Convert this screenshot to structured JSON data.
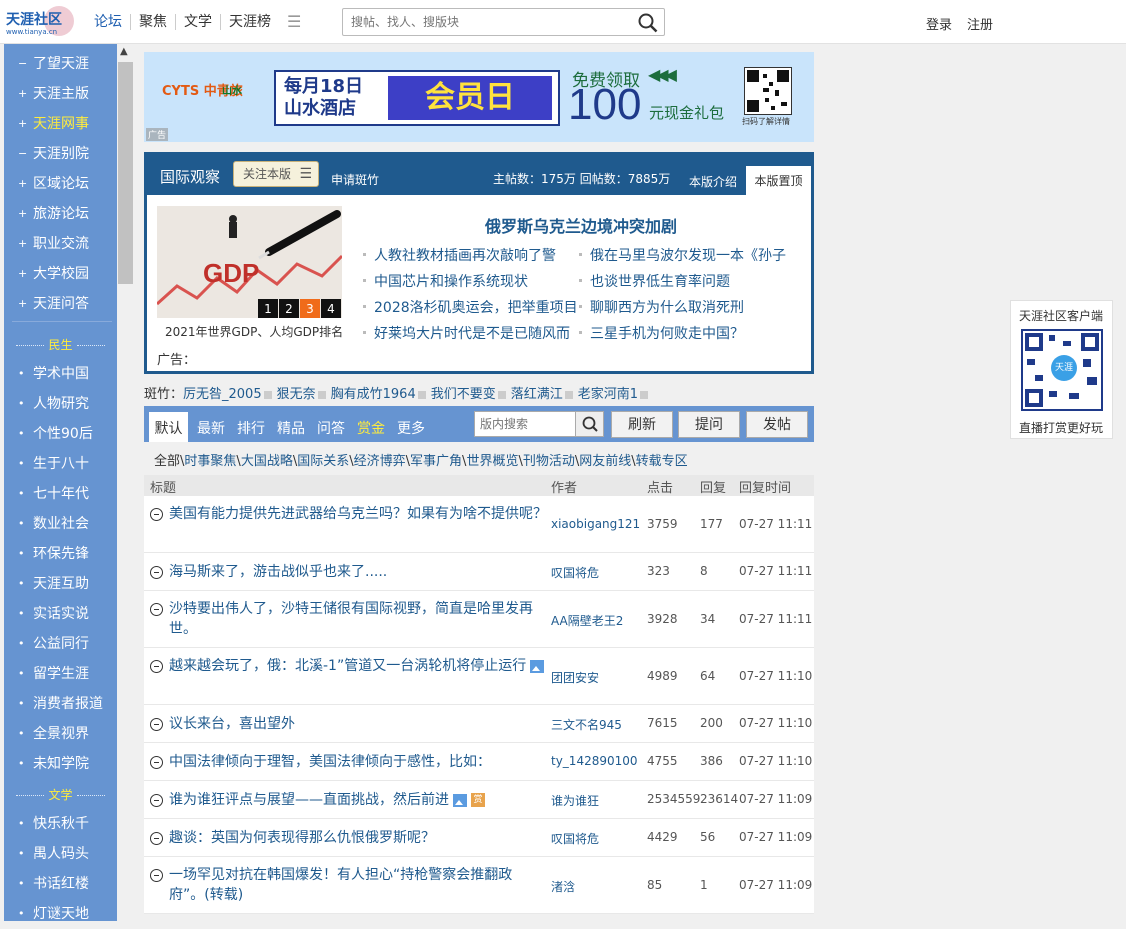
{
  "logo": {
    "text": "天涯社区",
    "url_text": "www.tianya.cn"
  },
  "topnav": {
    "items": [
      "论坛",
      "聚焦",
      "文学",
      "天涯榜"
    ],
    "menu_icon": "menu-icon"
  },
  "search": {
    "placeholder": "搜帖、找人、搜版块",
    "icon": "search-icon"
  },
  "account": {
    "login": "登录",
    "register": "注册"
  },
  "sidebar": {
    "items1": [
      "了望天涯",
      "天涯主版",
      "天涯网事",
      "天涯别院",
      "区域论坛",
      "旅游论坛",
      "职业交流",
      "大学校园",
      "天涯问答"
    ],
    "marks1": [
      "−",
      "+",
      "+",
      "−",
      "+",
      "+",
      "+",
      "+",
      "+"
    ],
    "highlight_index": 2,
    "section2": "民生",
    "items2": [
      "学术中国",
      "人物研究",
      "个性90后",
      "生于八十",
      "七十年代",
      "数业社会",
      "环保先锋",
      "天涯互助",
      "实话实说",
      "公益同行",
      "留学生涯",
      "消费者报道",
      "全景视界",
      "未知学院"
    ],
    "section3": "文学",
    "items3": [
      "快乐秋千",
      "禺人码头",
      "书话红楼",
      "灯谜天地"
    ]
  },
  "banner": {
    "logo_cits": "CYTS 中青旅",
    "logo_hotel": "山水",
    "monthly": "每月18日",
    "hotel": "山水酒店",
    "member_day": "会员日",
    "free": "免费领取",
    "amount": "100",
    "cash": "元现金礼包",
    "qr_caption": "扫码了解详情",
    "ad_label": "广告"
  },
  "board": {
    "title": "国际观察",
    "follow": "关注本版",
    "apply": "申请斑竹",
    "stats": "主帖数：175万 回帖数：7885万",
    "intro": "本版介绍",
    "top": "本版置顶",
    "pic_caption": "2021年世界GDP、人均GDP排名",
    "pic_text": "GDP",
    "pages": [
      "1",
      "2",
      "3",
      "4"
    ],
    "active_page": 2,
    "headline": "俄罗斯乌克兰边境冲突加剧",
    "news_left": [
      "人教社教材插画再次敲响了警",
      "中国芯片和操作系统现状",
      "2028洛杉矶奥运会，把举重项目",
      "好莱坞大片时代是不是已随风而"
    ],
    "news_right": [
      "俄在马里乌波尔发现一本《孙子",
      "也谈世界低生育率问题",
      "聊聊西方为什么取消死刑",
      "三星手机为何败走中国？"
    ],
    "ad": "广告："
  },
  "moderators": {
    "label": "斑竹：",
    "names": [
      "厉无咎_2005",
      "狠无奈",
      "胸有成竹1964",
      "我们不要变",
      "落红满江",
      "老家河南1"
    ]
  },
  "tabs": {
    "items": [
      "默认",
      "最新",
      "排行",
      "精品",
      "问答",
      "赏金",
      "更多"
    ],
    "search_placeholder": "版内搜索",
    "buttons": [
      "刷新",
      "提问",
      "发帖"
    ]
  },
  "categories": [
    "全部",
    "时事聚焦",
    "大国战略",
    "国际关系",
    "经济博弈",
    "军事广角",
    "世界概览",
    "刊物活动",
    "网友前线",
    "转载专区"
  ],
  "table": {
    "headers": [
      "标题",
      "作者",
      "点击",
      "回复",
      "回复时间"
    ],
    "rows": [
      {
        "title": "美国有能力提供先进武器给乌克兰吗？如果有为啥不提供呢？",
        "author": "xiaobigang121",
        "clicks": "3759",
        "replies": "177",
        "time": "07-27 11:11"
      },
      {
        "title": "海马斯来了，游击战似乎也来了.....",
        "author": "叹国将危",
        "clicks": "323",
        "replies": "8",
        "time": "07-27 11:11"
      },
      {
        "title": "沙特要出伟人了，沙特王储很有国际视野，简直是哈里发再世。",
        "author": "AA隔壁老王2",
        "clicks": "3928",
        "replies": "34",
        "time": "07-27 11:11"
      },
      {
        "title": "越来越会玩了，俄：北溪-1”管道又一台涡轮机将停止运行",
        "author": "团团安安",
        "clicks": "4989",
        "replies": "64",
        "time": "07-27 11:10"
      },
      {
        "title": "议长来台，喜出望外",
        "author": "三文不名945",
        "clicks": "7615",
        "replies": "200",
        "time": "07-27 11:10"
      },
      {
        "title": "中国法律倾向于理智，美国法律倾向于感性，比如：",
        "author": "ty_142890100",
        "clicks": "4755",
        "replies": "386",
        "time": "07-27 11:10"
      },
      {
        "title": "谁为谁狂评点与展望——直面挑战，然后前进",
        "author": "谁为谁狂",
        "clicks": "2534559",
        "replies": "23614",
        "time": "07-27 11:09"
      },
      {
        "title": "趣谈：英国为何表现得那么仇恨俄罗斯呢？",
        "author": "叹国将危",
        "clicks": "4429",
        "replies": "56",
        "time": "07-27 11:09"
      },
      {
        "title": "一场罕见对抗在韩国爆发！有人担心“持枪警察会推翻政府”。(转载)",
        "author": "渚浛",
        "clicks": "85",
        "replies": "1",
        "time": "07-27 11:09"
      }
    ],
    "reward_label": "赏"
  },
  "client": {
    "title": "天涯社区客户端",
    "logo": "天涯",
    "caption": "直播打赏更好玩"
  }
}
